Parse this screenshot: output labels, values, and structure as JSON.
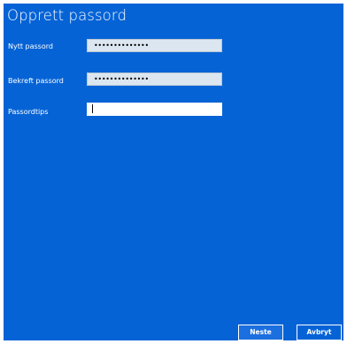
{
  "dialog": {
    "title": "Opprett passord"
  },
  "fields": {
    "new_password": {
      "label": "Nytt passord",
      "value": "••••••••••••••"
    },
    "confirm_password": {
      "label": "Bekreft passord",
      "value": "••••••••••••••"
    },
    "password_hint": {
      "label": "Passordtips",
      "value": ""
    }
  },
  "buttons": {
    "next_label": "Neste",
    "cancel_label": "Avbryt"
  },
  "colors": {
    "background": "#0563d6",
    "input_filled": "#dbe6f0",
    "input_active": "#ffffff",
    "text": "#ffffff"
  }
}
